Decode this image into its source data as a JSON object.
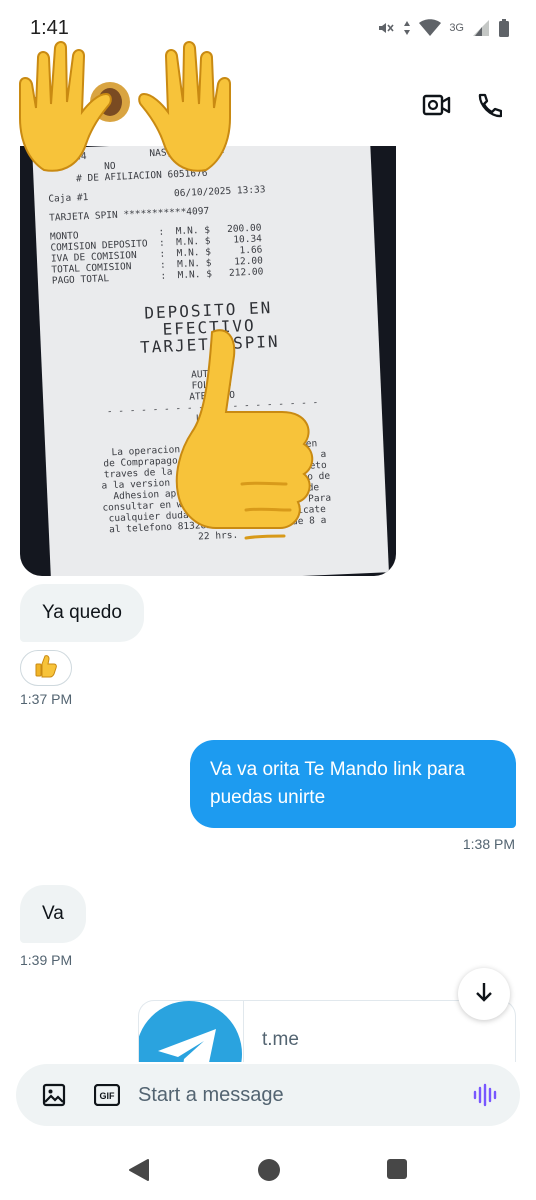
{
  "status_bar": {
    "time": "1:41",
    "network": "3G"
  },
  "header": {
    "contact_name": ""
  },
  "receipt_image": {
    "lines_top": [
      "S  #124           NAS, COAHUILA",
      "          NO",
      "     # DE AFILIACION 6051676"
    ],
    "caja": "Caja #1               06/10/2025 13:33",
    "tarjeta": "TARJETA SPIN ***********4097",
    "amounts": [
      "MONTO              :  M.N. $   200.00",
      "COMISION DEPOSITO  :  M.N. $    10.34",
      "IVA DE COMISION    :  M.N. $     1.66",
      "TOTAL COMISION     :  M.N. $    12.00",
      "PAGO TOTAL         :  M.N. $   212.00"
    ],
    "big_lines": [
      "DEPOSITO EN",
      "EFECTIVO",
      "TARJETA SPIN"
    ],
    "auth_lines": [
      "AUTORIZ",
      "FOLIO D",
      "ATENDIDO"
    ],
    "mid_lines": [
      "LA OPE",
      "ORDEN"
    ],
    "bottom_lines": [
      "La operacion                   orden",
      "de Comprapago, S.A. de C.V., I.F.P.E. a",
      "traves de la marca Spin by OXXO. Sujeto",
      "a la version actualizada del Contrato de",
      "Adhesion aplicable, el cual se puede",
      "consultar en www.spinbyoxxo.com.mx. Para",
      "cualquier duda o aclaracion comunicate",
      "al telefono 8132828282 de Lu-Do de 8 a",
      "22 hrs."
    ]
  },
  "messages": [
    {
      "text": "Ya quedo",
      "direction": "received"
    },
    {
      "text": "Va va orita Te Mando link para puedas unirte",
      "direction": "sent",
      "time": "1:38 PM"
    },
    {
      "text": "Va",
      "direction": "received",
      "time": "1:39 PM"
    }
  ],
  "reaction": {
    "emoji": "👍",
    "time": "1:37 PM"
  },
  "link_card": {
    "domain": "t.me"
  },
  "composer": {
    "placeholder": "Start a message"
  },
  "icons": {
    "back": "arrow-left-icon",
    "video": "video-camera-icon",
    "phone": "phone-icon",
    "media": "image-icon",
    "gif": "gif-icon",
    "voice": "voice-wave-icon",
    "scroll": "arrow-down-icon"
  },
  "colors": {
    "accent": "#1d9bf0",
    "incoming_bubble": "#eff3f4",
    "secondary_text": "#536471",
    "voice_purple": "#7856ff",
    "telegram_blue": "#2aa3df"
  }
}
